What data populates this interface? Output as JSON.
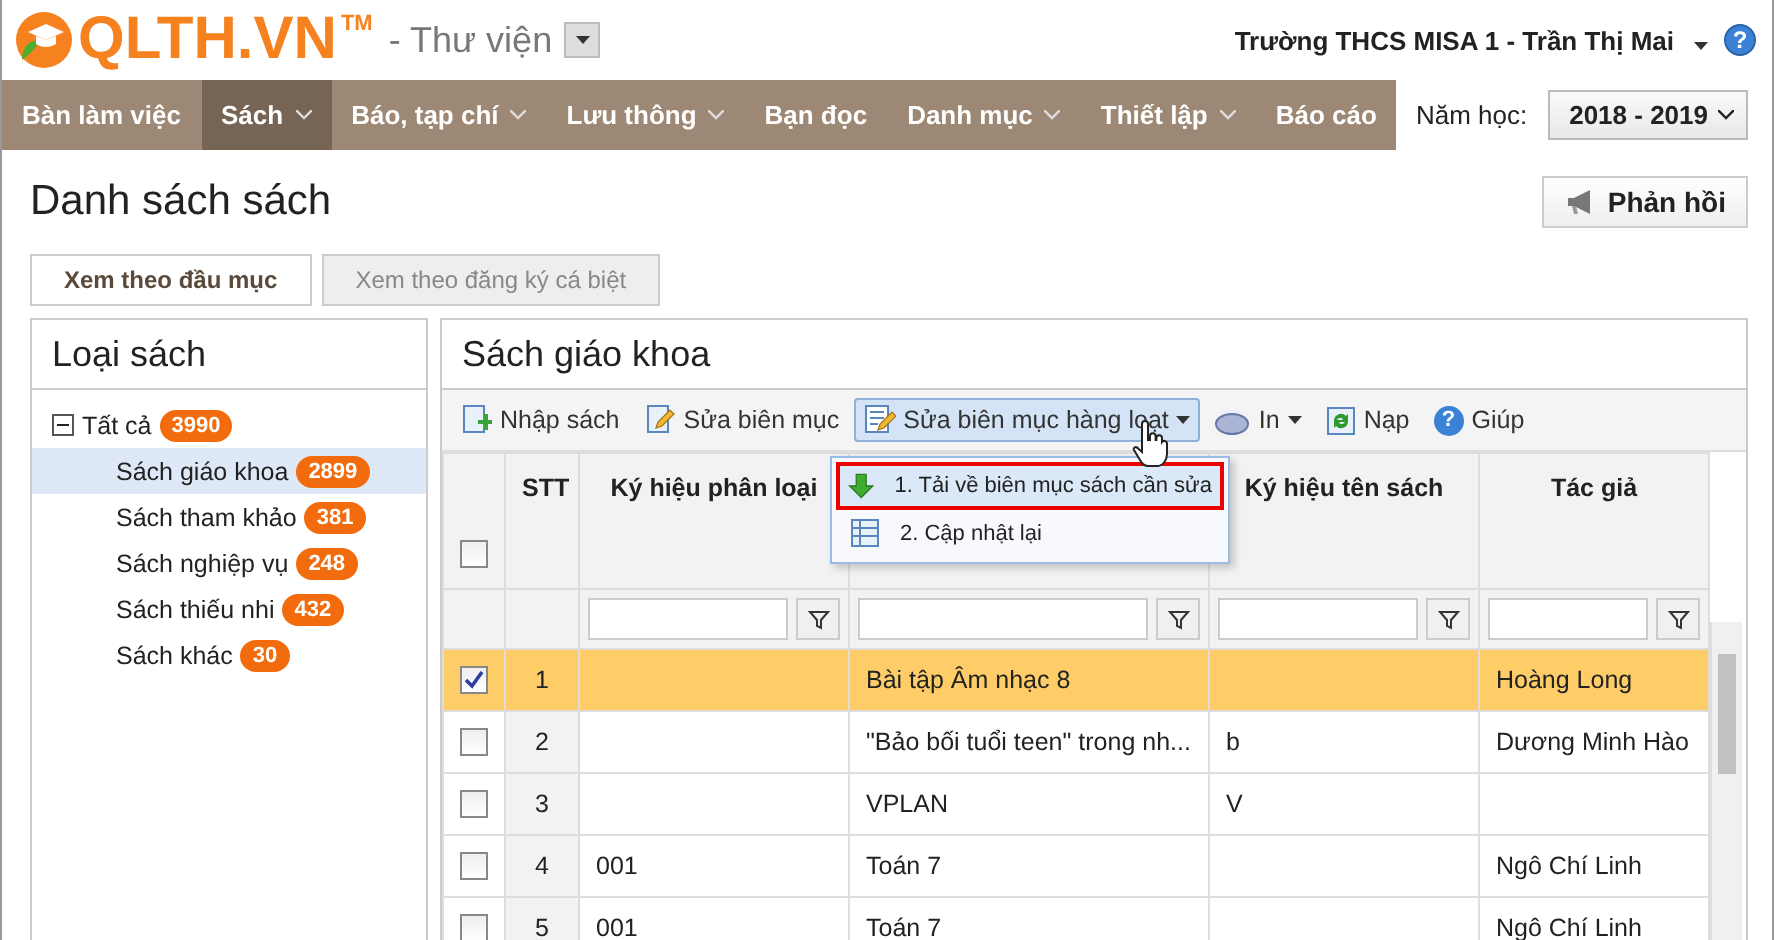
{
  "header": {
    "logo": "QLTH.VN",
    "trademark": "TM",
    "module": "- Thư viện",
    "user": "Trường THCS MISA 1 - Trần Thị Mai",
    "help_glyph": "?"
  },
  "nav": [
    {
      "label": "Bàn làm việc",
      "selected": false,
      "has_menu": false
    },
    {
      "label": "Sách",
      "selected": true,
      "has_menu": true
    },
    {
      "label": "Báo, tạp chí",
      "selected": false,
      "has_menu": true
    },
    {
      "label": "Lưu thông",
      "selected": false,
      "has_menu": true
    },
    {
      "label": "Bạn đọc",
      "selected": false,
      "has_menu": false
    },
    {
      "label": "Danh mục",
      "selected": false,
      "has_menu": true
    },
    {
      "label": "Thiết lập",
      "selected": false,
      "has_menu": true
    },
    {
      "label": "Báo cáo",
      "selected": false,
      "has_menu": false
    }
  ],
  "school_year": {
    "label": "Năm học:",
    "value": "2018 - 2019"
  },
  "page_title": "Danh sách sách",
  "feedback_button": "Phản hồi",
  "view_tabs": [
    {
      "label": "Xem theo đầu mục",
      "selected": true
    },
    {
      "label": "Xem theo đăng ký cá biệt",
      "selected": false
    }
  ],
  "sidebar": {
    "title": "Loại sách",
    "tree": [
      {
        "label": "Tất cả",
        "count": "3990",
        "expanded": true,
        "selected": false,
        "children": [
          {
            "label": "Sách giáo khoa",
            "count": "2899",
            "selected": true
          },
          {
            "label": "Sách tham khảo",
            "count": "381",
            "selected": false
          },
          {
            "label": "Sách nghiệp vụ",
            "count": "248",
            "selected": false
          },
          {
            "label": "Sách thiếu nhi",
            "count": "432",
            "selected": false
          },
          {
            "label": "Sách khác",
            "count": "30",
            "selected": false
          }
        ]
      }
    ]
  },
  "content": {
    "title": "Sách giáo khoa",
    "toolbar": [
      {
        "label": "Nhập sách",
        "kind": "add",
        "has_menu": false,
        "pressed": false
      },
      {
        "label": "Sửa biên mục",
        "kind": "edit",
        "has_menu": false,
        "pressed": false
      },
      {
        "label": "Sửa biên mục hàng loạt",
        "kind": "batch",
        "has_menu": true,
        "pressed": true
      },
      {
        "label": "In",
        "kind": "print",
        "has_menu": true,
        "pressed": false
      },
      {
        "label": "Nạp",
        "kind": "reload",
        "has_menu": false,
        "pressed": false
      },
      {
        "label": "Giúp",
        "kind": "help",
        "icon_text": "?",
        "has_menu": false,
        "pressed": false
      }
    ],
    "menu": [
      {
        "label": "1. Tải về biên mục sách cần sửa",
        "kind": "download",
        "selected": true
      },
      {
        "label": "2. Cập nhật lại",
        "kind": "update",
        "selected": false
      }
    ],
    "table": {
      "all_checked": false,
      "columns": [
        {
          "label": "STT",
          "filter": false
        },
        {
          "label": "Ký hiệu phân loại",
          "filter": true
        },
        {
          "filter": true
        },
        {
          "label": "Ký hiệu tên sách",
          "filter": true
        },
        {
          "label": "Tác giả",
          "filter": true
        }
      ],
      "rows": [
        {
          "checked": true,
          "selected": true,
          "cells": [
            "1",
            null,
            "Bài tập Âm nhạc 8",
            null,
            "Hoàng Long"
          ]
        },
        {
          "checked": false,
          "selected": false,
          "cells": [
            "2",
            null,
            "\"Bảo bối tuổi teen\" trong nh...",
            "b",
            "Dương Minh Hào"
          ]
        },
        {
          "checked": false,
          "selected": false,
          "cells": [
            "3",
            null,
            "VPLAN",
            "V",
            null
          ]
        },
        {
          "checked": false,
          "selected": false,
          "cells": [
            "4",
            "001",
            "Toán 7",
            null,
            "Ngô Chí Linh"
          ]
        },
        {
          "checked": false,
          "selected": false,
          "cells": [
            "5",
            "001",
            "Toán 7",
            null,
            "Ngô Chí Linh"
          ]
        }
      ]
    }
  }
}
